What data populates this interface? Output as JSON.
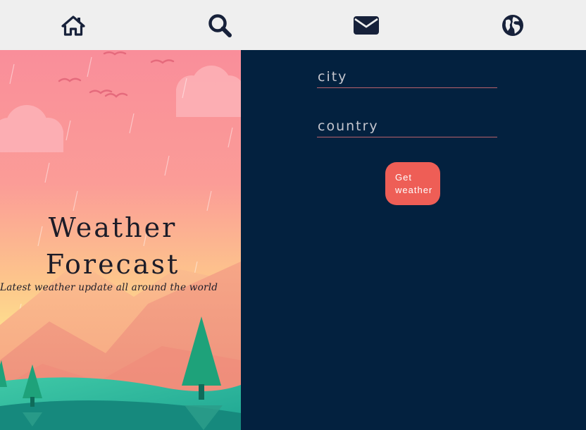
{
  "nav": {
    "items": [
      {
        "icon": "home-icon"
      },
      {
        "icon": "search-icon"
      },
      {
        "icon": "envelope-icon"
      },
      {
        "icon": "globe-icon"
      }
    ]
  },
  "hero": {
    "title_line1": "Weather",
    "title_line2": "Forecast",
    "subtitle": "Latest weather update all around the world"
  },
  "form": {
    "city_placeholder": "city",
    "city_value": "",
    "country_placeholder": "country",
    "country_value": "",
    "submit_label": "Get weather"
  },
  "colors": {
    "nav_bg": "#efefef",
    "page_bg": "#03213f",
    "button": "#ee5e56",
    "field_underline": "#b8626b"
  }
}
